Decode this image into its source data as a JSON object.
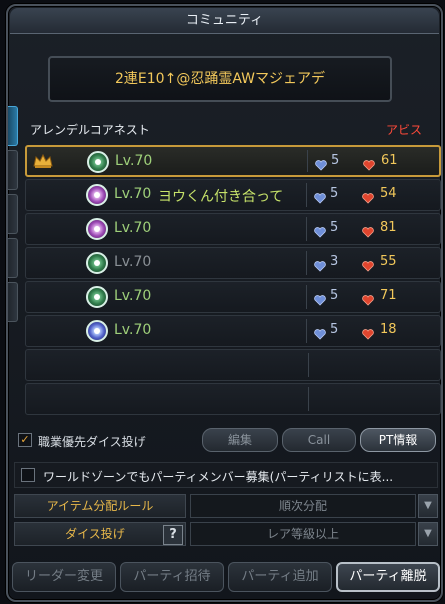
{
  "window": {
    "title": "コミュニティ"
  },
  "party": {
    "name": "2連E10↑@忍踊霊AWマジェアデ"
  },
  "list_header": {
    "dungeon": "アレンデルコアネスト",
    "difficulty": "アビス"
  },
  "members": [
    {
      "leader": true,
      "class_color": "green",
      "level": "Lv.70",
      "name": "",
      "blue": "5",
      "red": "61",
      "dim": false
    },
    {
      "leader": false,
      "class_color": "purple",
      "level": "Lv.70",
      "name": "ヨウくん付き合って",
      "blue": "5",
      "red": "54",
      "dim": false
    },
    {
      "leader": false,
      "class_color": "purple",
      "level": "Lv.70",
      "name": "",
      "blue": "5",
      "red": "81",
      "dim": false
    },
    {
      "leader": false,
      "class_color": "green",
      "level": "Lv.70",
      "name": "",
      "blue": "3",
      "red": "55",
      "dim": true
    },
    {
      "leader": false,
      "class_color": "green",
      "level": "Lv.70",
      "name": "",
      "blue": "5",
      "red": "71",
      "dim": false
    },
    {
      "leader": false,
      "class_color": "blue",
      "level": "Lv.70",
      "name": "",
      "blue": "5",
      "red": "18",
      "dim": false
    }
  ],
  "options": {
    "class_priority_dice": "職業優先ダイス投げ",
    "class_priority_checked": "✓",
    "edit_button": "編集",
    "call_button": "Call",
    "pt_info_button": "PT情報"
  },
  "world_zone": {
    "label": "ワールドゾーンでもパーティメンバー募集(パーティリストに表..."
  },
  "settings": {
    "item_rule_label": "アイテム分配ルール",
    "item_rule_value": "順次分配",
    "dice_label": "ダイス投げ",
    "dice_help": "?",
    "dice_value": "レア等級以上",
    "dropdown_arrow": "▼"
  },
  "bottom": {
    "leader_change": "リーダー変更",
    "party_invite": "パーティ招待",
    "party_add": "パーティ追加",
    "party_leave": "パーティ離脱"
  },
  "colors": {
    "accent_gold": "#f2c85b",
    "difficulty_red": "#ff4a3a"
  }
}
